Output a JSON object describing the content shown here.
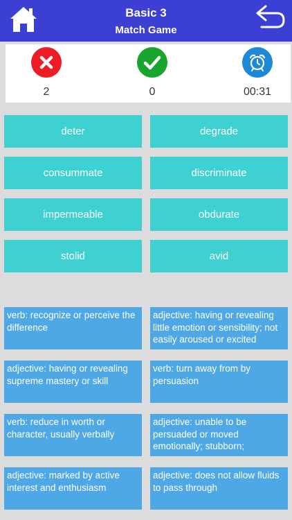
{
  "header": {
    "title": "Basic 3",
    "subtitle": "Match Game",
    "home_icon": "home-icon",
    "back_icon": "back-arrow-icon",
    "color": "#3c3fd4"
  },
  "scoreboard": {
    "wrong_count": "2",
    "correct_count": "0",
    "timer": "00:31",
    "wrong_icon": "x-icon",
    "correct_icon": "check-icon",
    "timer_icon": "alarm-clock-icon"
  },
  "words": [
    {
      "label": "deter"
    },
    {
      "label": "degrade"
    },
    {
      "label": "consummate"
    },
    {
      "label": "discriminate"
    },
    {
      "label": "impermeable"
    },
    {
      "label": "obdurate"
    },
    {
      "label": "stolid"
    },
    {
      "label": "avid"
    }
  ],
  "definitions": [
    {
      "text": "verb: recognize or perceive the difference"
    },
    {
      "text": "adjective: having or revealing little emotion or sensibility; not easily aroused or excited"
    },
    {
      "text": "adjective: having or revealing supreme mastery or skill"
    },
    {
      "text": "verb: turn away from by persuasion"
    },
    {
      "text": "verb: reduce in worth or character, usually verbally"
    },
    {
      "text": "adjective: unable to be persuaded or moved emotionally; stubborn;"
    },
    {
      "text": "adjective: marked by active interest and enthusiasm"
    },
    {
      "text": "adjective: does not allow fluids to pass through"
    }
  ],
  "colors": {
    "word_tile": "#3fd1d1",
    "definition_tile": "#4fa8e6",
    "wrong": "#ee1c24",
    "correct": "#17a52e",
    "timer": "#1d89d6"
  }
}
